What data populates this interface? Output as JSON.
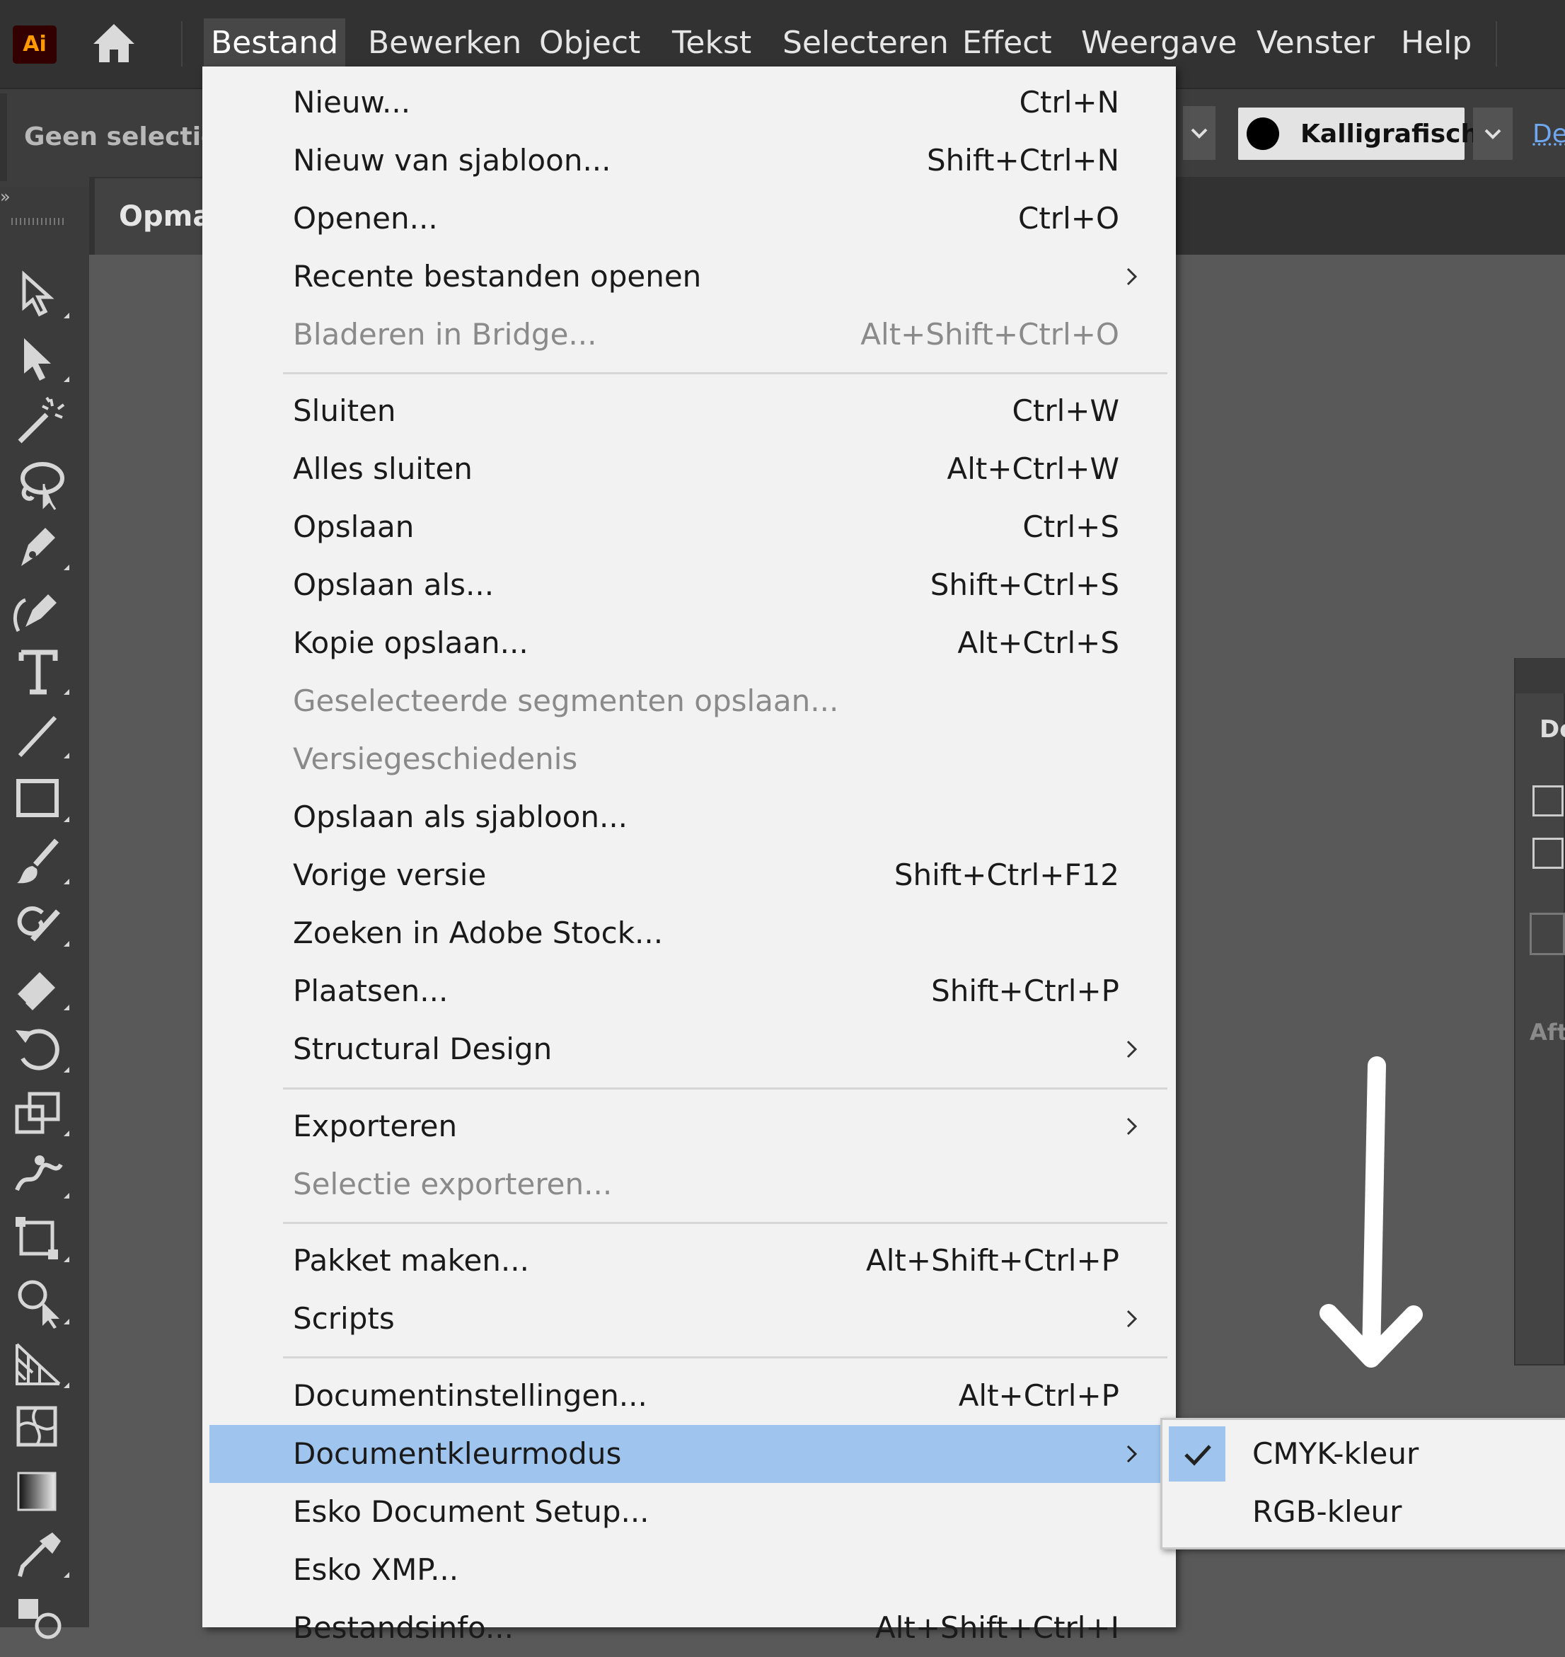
{
  "app": {
    "logo_text": "Ai",
    "logo_color": "#FF9A00"
  },
  "menubar": {
    "items": [
      "Bestand",
      "Bewerken",
      "Object",
      "Tekst",
      "Selecteren",
      "Effect",
      "Weergave",
      "Venster",
      "Help"
    ],
    "active": "Bestand"
  },
  "controlbar": {
    "selection_status": "Geen selectie",
    "brush_label": "Kalligrafisch...",
    "truncated_label": "De"
  },
  "document_tab": {
    "label": "Opma"
  },
  "right_panel": {
    "title_fragment": "Do",
    "label_fragment": "Aft"
  },
  "toolbar": {
    "collapse_glyph": "»",
    "tools": [
      "direct-selection-icon",
      "selection-icon",
      "magic-wand-icon",
      "lasso-icon",
      "pen-icon",
      "curvature-icon",
      "type-icon",
      "line-icon",
      "rectangle-icon",
      "paintbrush-icon",
      "shaper-icon",
      "eraser-icon",
      "rotate-icon",
      "scale-icon",
      "puppet-warp-icon",
      "free-transform-icon",
      "shape-builder-icon",
      "perspective-grid-icon",
      "mesh-icon",
      "gradient-icon",
      "eyedropper-icon",
      "blend-icon"
    ]
  },
  "file_menu": {
    "items": [
      {
        "label": "Nieuw...",
        "shortcut": "Ctrl+N"
      },
      {
        "label": "Nieuw van sjabloon...",
        "shortcut": "Shift+Ctrl+N"
      },
      {
        "label": "Openen...",
        "shortcut": "Ctrl+O"
      },
      {
        "label": "Recente bestanden openen",
        "submenu": true
      },
      {
        "label": "Bladeren in Bridge...",
        "shortcut": "Alt+Shift+Ctrl+O",
        "disabled": true
      },
      {
        "label": "Sluiten",
        "shortcut": "Ctrl+W"
      },
      {
        "label": "Alles sluiten",
        "shortcut": "Alt+Ctrl+W"
      },
      {
        "label": "Opslaan",
        "shortcut": "Ctrl+S"
      },
      {
        "label": "Opslaan als...",
        "shortcut": "Shift+Ctrl+S"
      },
      {
        "label": "Kopie opslaan...",
        "shortcut": "Alt+Ctrl+S"
      },
      {
        "label": "Geselecteerde segmenten opslaan...",
        "disabled": true
      },
      {
        "label": "Versiegeschiedenis",
        "disabled": true
      },
      {
        "label": "Opslaan als sjabloon..."
      },
      {
        "label": "Vorige versie",
        "shortcut": "Shift+Ctrl+F12"
      },
      {
        "label": "Zoeken in Adobe Stock..."
      },
      {
        "label": "Plaatsen...",
        "shortcut": "Shift+Ctrl+P"
      },
      {
        "label": "Structural Design",
        "submenu": true
      },
      {
        "label": "Exporteren",
        "submenu": true
      },
      {
        "label": "Selectie exporteren...",
        "disabled": true
      },
      {
        "label": "Pakket maken...",
        "shortcut": "Alt+Shift+Ctrl+P"
      },
      {
        "label": "Scripts",
        "submenu": true
      },
      {
        "label": "Documentinstellingen...",
        "shortcut": "Alt+Ctrl+P"
      },
      {
        "label": "Documentkleurmodus",
        "submenu": true,
        "highlighted": true
      },
      {
        "label": "Esko Document Setup..."
      },
      {
        "label": "Esko XMP..."
      },
      {
        "label": "Bestandsinfo...",
        "shortcut": "Alt+Shift+Ctrl+I"
      }
    ]
  },
  "color_mode_submenu": {
    "items": [
      {
        "label": "CMYK-kleur",
        "checked": true
      },
      {
        "label": "RGB-kleur",
        "checked": false
      }
    ]
  },
  "colors": {
    "menu_bg": "#F2F2F2",
    "highlight": "#9FC5EE",
    "ui_dark": "#323232",
    "canvas": "#595959",
    "annotation_arrow": "#FFFFFF"
  }
}
